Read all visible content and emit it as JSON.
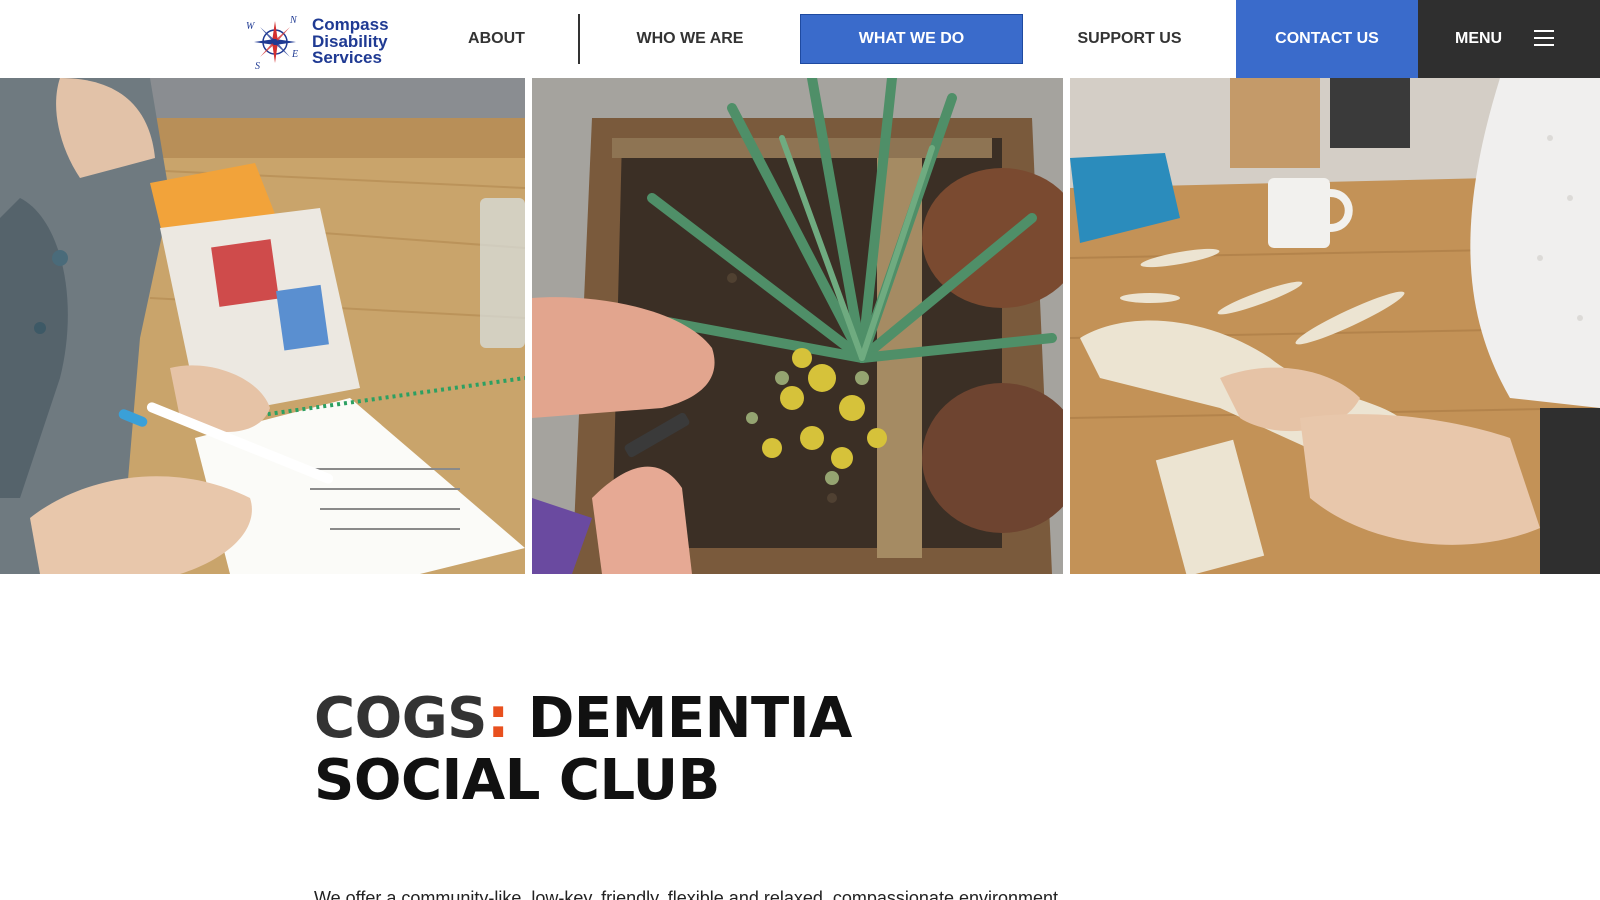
{
  "header": {
    "logo": {
      "line1": "Compass",
      "line2": "Disability",
      "line3": "Services",
      "compass_letters": [
        "N",
        "E",
        "S",
        "W"
      ]
    },
    "nav": {
      "about": "ABOUT",
      "who_we_are": "WHO WE ARE",
      "what_we_do": "WHAT WE DO",
      "support_us": "SUPPORT US",
      "contact_us": "CONTACT US",
      "menu": "MENU"
    },
    "active_item": "what_we_do"
  },
  "colors": {
    "accent_blue": "#3a6bcb",
    "menu_dark": "#2f2f2f",
    "title_colon": "#e8501e",
    "logo_blue": "#1f3a93"
  },
  "photos": [
    {
      "subject": "word-search-activity"
    },
    {
      "subject": "gardening-planter"
    },
    {
      "subject": "wooden-model-craft"
    }
  ],
  "main": {
    "title_part1": "COGS",
    "title_colon": ":",
    "title_part2": " DEMENTIA",
    "title_line2": "SOCIAL CLUB",
    "intro_text": "We offer a community-like, low-key, friendly, flexible and relaxed, compassionate environment..."
  }
}
